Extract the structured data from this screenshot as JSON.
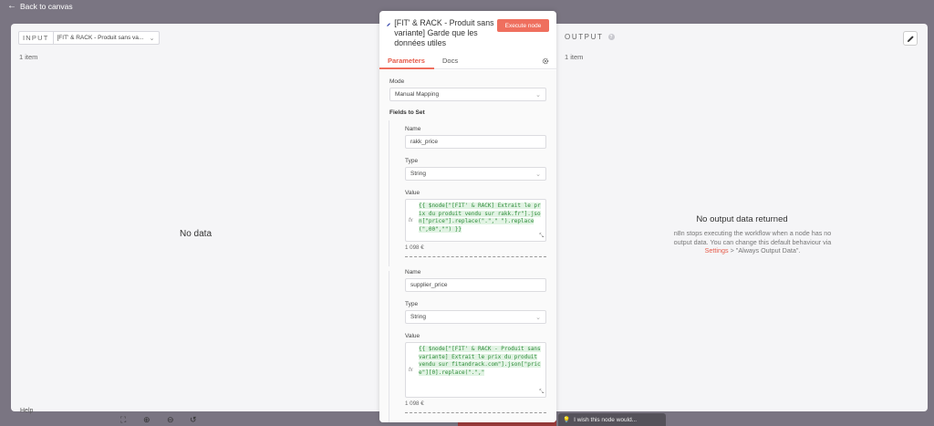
{
  "header": {
    "back_label": "Back to canvas"
  },
  "input_panel": {
    "tag": "INPUT",
    "node_select": "[FIT' & RACK - Produit sans va...",
    "item_count": "1 item",
    "empty_message": "No data"
  },
  "output_panel": {
    "tag": "OUTPUT",
    "item_count": "1 item",
    "empty_title": "No output data returned",
    "empty_desc_before": "n8n stops executing the workflow when a node has no output data. You can change this default behaviour via ",
    "settings_link": "Settings",
    "empty_desc_after": " > \"Always Output Data\"."
  },
  "node": {
    "title": "[FIT' & RACK - Produit sans variante] Garde que les données utiles",
    "execute_label": "Execute node",
    "tabs": {
      "parameters": "Parameters",
      "docs": "Docs"
    },
    "mode_label": "Mode",
    "mode_value": "Manual Mapping",
    "fields_label": "Fields to Set",
    "fields": [
      {
        "name_label": "Name",
        "name_value": "rakk_price",
        "type_label": "Type",
        "type_value": "String",
        "value_label": "Value",
        "expression": "{{ $node[\"[FIT' & RACK] Extrait le prix du produit vendu sur rakk.fr\"].json[\"price\"].replace(\".\",\" \").replace(\",00\",\"\") }}",
        "result": "1 098 €"
      },
      {
        "name_label": "Name",
        "name_value": "supplier_price",
        "type_label": "Type",
        "type_value": "String",
        "value_label": "Value",
        "expression": "{{ $node[\"[FIT' & RACK - Produit sans variante] Extrait le prix du produit vendu sur fitandrack.com\"].json[\"price\"][0].replace(\".\",\"",
        "result": "1 098 €"
      }
    ]
  },
  "footer": {
    "help_label": "Help",
    "feedback_label": "I wish this node would..."
  },
  "colors": {
    "accent": "#ef6f5e",
    "code": "#2e8c3a"
  }
}
